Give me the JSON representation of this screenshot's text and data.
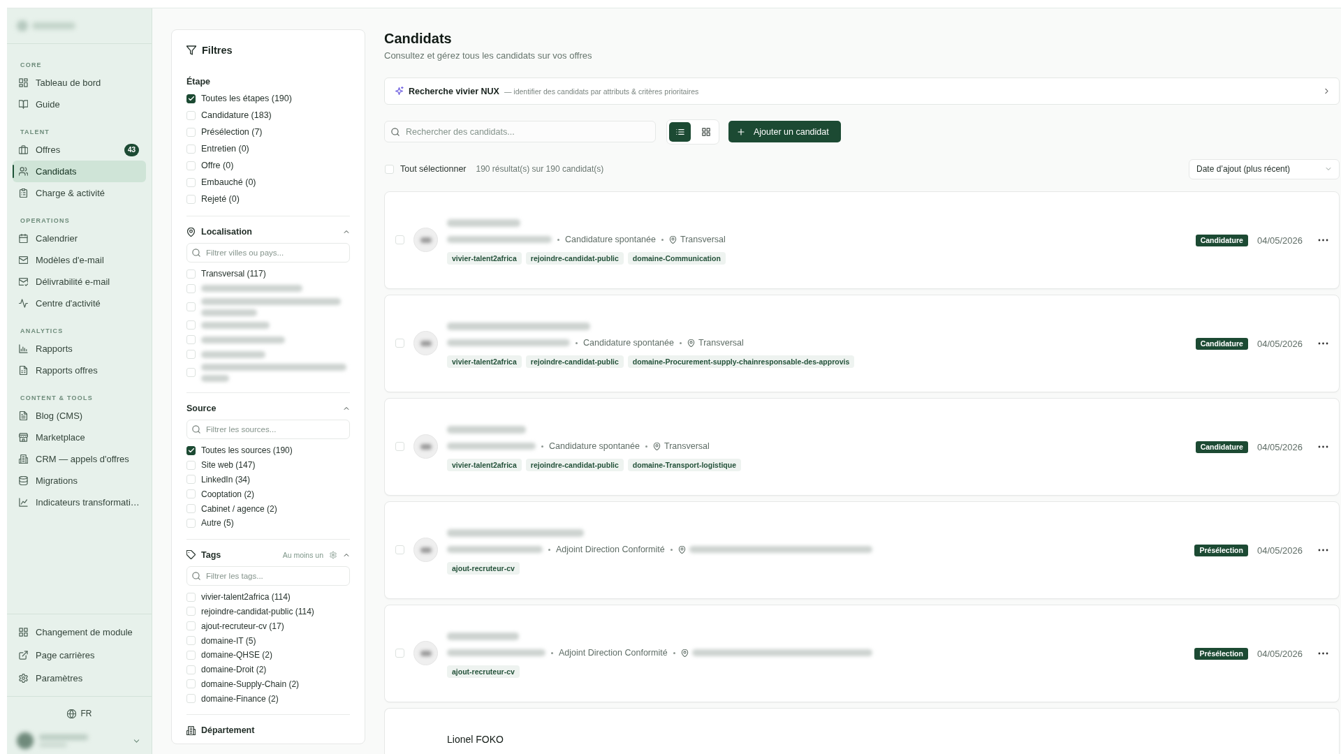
{
  "sidebar": {
    "brand": {
      "redacted": true
    },
    "sections": [
      {
        "title": "CORE",
        "items": [
          {
            "label": "Tableau de bord",
            "selected": false
          },
          {
            "label": "Guide",
            "selected": false
          }
        ]
      },
      {
        "title": "TALENT",
        "items": [
          {
            "label": "Offres",
            "selected": false,
            "badge": "43"
          },
          {
            "label": "Candidats",
            "selected": true
          },
          {
            "label": "Charge & activité",
            "selected": false
          }
        ]
      },
      {
        "title": "OPERATIONS",
        "items": [
          {
            "label": "Calendrier",
            "selected": false
          },
          {
            "label": "Modèles d'e-mail",
            "selected": false
          },
          {
            "label": "Délivrabilité e-mail",
            "selected": false
          },
          {
            "label": "Centre d'activité",
            "selected": false
          }
        ]
      },
      {
        "title": "ANALYTICS",
        "items": [
          {
            "label": "Rapports",
            "selected": false
          },
          {
            "label": "Rapports offres",
            "selected": false
          }
        ]
      },
      {
        "title": "CONTENT & TOOLS",
        "items": [
          {
            "label": "Blog (CMS)",
            "selected": false
          },
          {
            "label": "Marketplace",
            "selected": false
          },
          {
            "label": "CRM — appels d'offres",
            "selected": false
          },
          {
            "label": "Migrations",
            "selected": false
          },
          {
            "label": "Indicateurs transformati…",
            "selected": false
          }
        ]
      }
    ],
    "footer_items": [
      {
        "label": "Changement de module",
        "selected": false
      },
      {
        "label": "Page carrières",
        "selected": false
      },
      {
        "label": "Paramètres",
        "selected": false
      }
    ],
    "language": "FR",
    "user": {
      "redacted": true,
      "expanded": false
    }
  },
  "filters": {
    "title": "Filtres",
    "groups": [
      {
        "kind": "plain",
        "title": "Étape",
        "options": [
          {
            "label": "Toutes les étapes (190)",
            "checked": true
          },
          {
            "label": "Candidature (183)",
            "checked": false
          },
          {
            "label": "Présélection (7)",
            "checked": false
          },
          {
            "label": "Entretien (0)",
            "checked": false
          },
          {
            "label": "Offre (0)",
            "checked": false
          },
          {
            "label": "Embauché (0)",
            "checked": false
          },
          {
            "label": "Rejeté (0)",
            "checked": false
          }
        ]
      },
      {
        "kind": "searchable",
        "title": "Localisation",
        "expanded": true,
        "search": {
          "placeholder": "Filtrer villes ou pays..."
        },
        "options": [
          {
            "label": "Transversal (117)",
            "checked": false
          },
          {
            "redacted": true,
            "wrapped": false,
            "checked": false
          },
          {
            "redacted": true,
            "wrapped": true,
            "checked": false
          },
          {
            "redacted": true,
            "wrapped": false,
            "checked": false
          },
          {
            "redacted": true,
            "wrapped": false,
            "checked": false
          },
          {
            "redacted": true,
            "wrapped": false,
            "checked": false
          },
          {
            "redacted": true,
            "wrapped": true,
            "checked": false
          }
        ]
      },
      {
        "kind": "searchable",
        "title": "Source",
        "expanded": true,
        "search": {
          "placeholder": "Filtrer les sources..."
        },
        "options": [
          {
            "label": "Toutes les sources (190)",
            "checked": true
          },
          {
            "label": "Site web (147)",
            "checked": false
          },
          {
            "label": "LinkedIn (34)",
            "checked": false
          },
          {
            "label": "Cooptation (2)",
            "checked": false
          },
          {
            "label": "Cabinet / agence (2)",
            "checked": false
          },
          {
            "label": "Autre (5)",
            "checked": false
          }
        ]
      },
      {
        "kind": "searchable",
        "title": "Tags",
        "expanded": true,
        "match_mode": "Au moins un",
        "search": {
          "placeholder": "Filtrer les tags..."
        },
        "options": [
          {
            "label": "vivier-talent2africa (114)",
            "checked": false
          },
          {
            "label": "rejoindre-candidat-public (114)",
            "checked": false
          },
          {
            "label": "ajout-recruteur-cv (17)",
            "checked": false
          },
          {
            "label": "domaine-IT (5)",
            "checked": false
          },
          {
            "label": "domaine-QHSE (2)",
            "checked": false
          },
          {
            "label": "domaine-Droit (2)",
            "checked": false
          },
          {
            "label": "domaine-Supply-Chain (2)",
            "checked": false
          },
          {
            "label": "domaine-Finance (2)",
            "checked": false
          }
        ]
      },
      {
        "kind": "header",
        "title": "Département"
      }
    ]
  },
  "main": {
    "title": "Candidats",
    "subtitle": "Consultez et gérez tous les candidats sur vos offres",
    "nux": {
      "title": "Recherche vivier NUX",
      "description": "— identifier des candidats par attributs & critères prioritaires"
    },
    "search": {
      "placeholder": "Rechercher des candidats..."
    },
    "view_modes": [
      {
        "selected": true
      },
      {
        "selected": false
      }
    ],
    "add_button": "Ajouter un candidat",
    "select_all": {
      "label": "Tout sélectionner",
      "checked": false
    },
    "results": "190 résultat(s) sur 190 candidat(s)",
    "sort": {
      "value": "Date d’ajout (plus récent)"
    },
    "candidates": [
      {
        "selected": false,
        "name_redacted": true,
        "email_redacted": true,
        "offer": "Candidature spontanée",
        "location": "Transversal",
        "tags": [
          "vivier-talent2africa",
          "rejoindre-candidat-public",
          "domaine-Communication"
        ],
        "status": "Candidature",
        "date": "04/05/2026"
      },
      {
        "selected": false,
        "name_redacted": true,
        "email_redacted": true,
        "offer": "Candidature spontanée",
        "location": "Transversal",
        "tags": [
          "vivier-talent2africa",
          "rejoindre-candidat-public",
          "domaine-Procurement-supply-chainresponsable-des-approvis"
        ],
        "status": "Candidature",
        "date": "04/05/2026"
      },
      {
        "selected": false,
        "name_redacted": true,
        "email_redacted": true,
        "offer": "Candidature spontanée",
        "location": "Transversal",
        "tags": [
          "vivier-talent2africa",
          "rejoindre-candidat-public",
          "domaine-Transport-logistique"
        ],
        "status": "Candidature",
        "date": "04/05/2026"
      },
      {
        "selected": false,
        "name_redacted": true,
        "email_redacted": true,
        "offer": "Adjoint Direction Conformité",
        "location_redacted": true,
        "tags": [
          "ajout-recruteur-cv"
        ],
        "status": "Présélection",
        "date": "04/05/2026"
      },
      {
        "selected": false,
        "name_redacted": true,
        "email_redacted": true,
        "offer": "Adjoint Direction Conformité",
        "location_redacted": true,
        "tags": [
          "ajout-recruteur-cv"
        ],
        "status": "Présélection",
        "date": "04/05/2026"
      },
      {
        "name": "Lionel FOKO"
      }
    ]
  }
}
